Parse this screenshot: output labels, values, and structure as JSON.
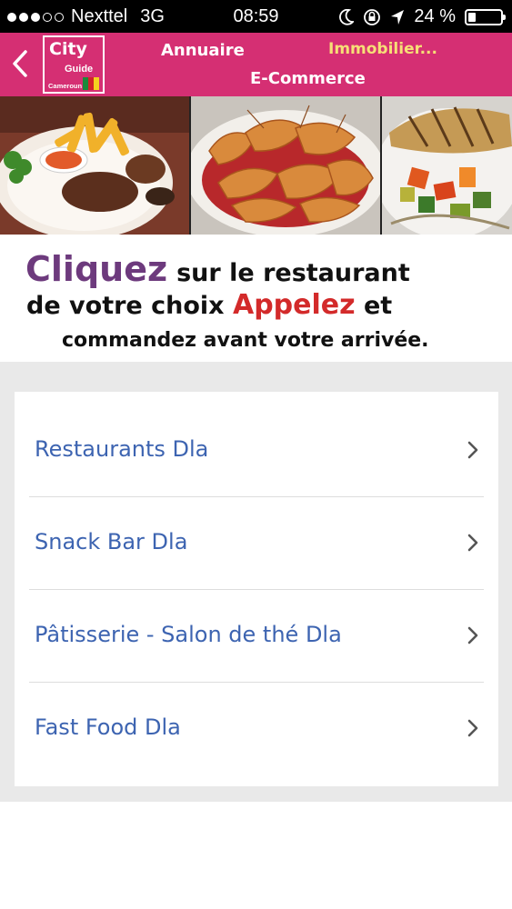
{
  "status_bar": {
    "carrier": "Nexttel",
    "network": "3G",
    "time": "08:59",
    "battery_text": "24 %",
    "battery_level": 0.24
  },
  "header": {
    "back_icon": "chevron-left-icon",
    "logo": {
      "city": "City",
      "guide": "Guide",
      "country": "Cameroun"
    },
    "nav": {
      "annuaire": "Annuaire",
      "immobilier": "Immobilier...",
      "ecommerce": "E-Commerce"
    },
    "colors": {
      "bar": "#d52f73",
      "highlight": "#f6df76"
    }
  },
  "slogan": {
    "cliquez": "Cliquez",
    "line1_rest": "sur le restaurant",
    "line2_start": "de votre choix",
    "appelez": "Appelez",
    "line2_end": "et",
    "line3": "commandez avant votre arrivée."
  },
  "list": {
    "items": [
      {
        "label": "Restaurants Dla",
        "icon": "chevron-right-icon"
      },
      {
        "label": "Snack Bar Dla",
        "icon": "chevron-right-icon"
      },
      {
        "label": "Pâtisserie - Salon de thé Dla",
        "icon": "chevron-right-icon"
      },
      {
        "label": "Fast Food Dla",
        "icon": "chevron-right-icon"
      }
    ],
    "colors": {
      "text": "#3d64b1",
      "background": "#e9e9e9"
    }
  }
}
